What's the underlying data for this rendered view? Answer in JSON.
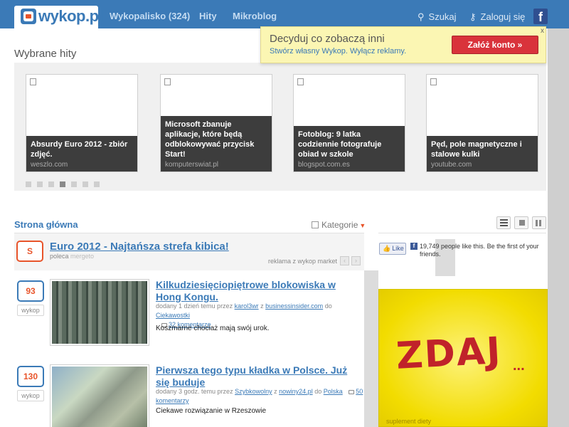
{
  "header": {
    "logo": "wykop.pl",
    "nav": [
      "Wykopalisko (324)",
      "Hity",
      "Mikroblog"
    ],
    "search": "Szukaj",
    "login": "Zaloguj się",
    "facebook": "f"
  },
  "promo": {
    "title": "Decyduj co zobaczą inni",
    "subtitle": "Stwórz własny Wykop. Wyłącz reklamy.",
    "button": "Załóż konto »",
    "close": "x"
  },
  "hits": {
    "title": "Wybrane hity",
    "cards": [
      {
        "title": "Absurdy Euro 2012 - zbiór zdjęć.",
        "source": "weszlo.com"
      },
      {
        "title": "Microsoft zbanuje aplikacje, które będą odblokowywać przycisk Start!",
        "source": "komputerswiat.pl"
      },
      {
        "title": "Fotoblog: 9 latka codziennie fotografuje obiad w szkole",
        "source": "blogspot.com.es"
      },
      {
        "title": "Pęd, pole magnetyczne i stalowe kulki",
        "source": "youtube.com"
      }
    ],
    "active_dot": 4,
    "dot_count": 7
  },
  "main": {
    "title": "Strona główna",
    "category": "Kategorie",
    "sponsored": {
      "badge": "S",
      "title": "Euro 2012 - Najtańsza strefa kibica!",
      "meta_prefix": "poleca",
      "meta_author": "mergeto",
      "ad_label": "reklama z wykop market",
      "prev": "‹",
      "next": "›"
    },
    "entries": [
      {
        "votes": "93",
        "vote_label": "wykop",
        "title": "Kilkudziesięciopiętrowe blokowiska w Hong Kongu.",
        "meta_added": "dodany 1 dzień temu przez",
        "author": "karol3wr",
        "meta_from": "z",
        "source": "businessinsider.com",
        "meta_to": "do",
        "category": "Ciekawostki",
        "comments": "32 komentarze",
        "description": "Koszmarne chociaż mają swój urok."
      },
      {
        "votes": "130",
        "vote_label": "wykop",
        "title": "Pierwsza tego typu kładka w Polsce. Już się buduje",
        "meta_added": "dodany 3 godz. temu przez",
        "author": "Szybkowolny",
        "meta_from": "z",
        "source": "nowiny24.pl",
        "meta_to": "do",
        "category": "Polska",
        "comments_num": "50",
        "comments_word": "komentarzy",
        "description": "Ciekawe rozwiązanie w Rzeszowie"
      }
    ]
  },
  "sidebar": {
    "like": "Like",
    "like_text": "19,749 people like this. Be the first of your friends.",
    "ad_text": "ZDAJ",
    "ad_dots": "...",
    "ad_footer": "suplement diety"
  },
  "colors": {
    "brand_blue": "#3b7ab7",
    "accent_orange": "#e8542a",
    "promo_button": "#d9333b"
  }
}
